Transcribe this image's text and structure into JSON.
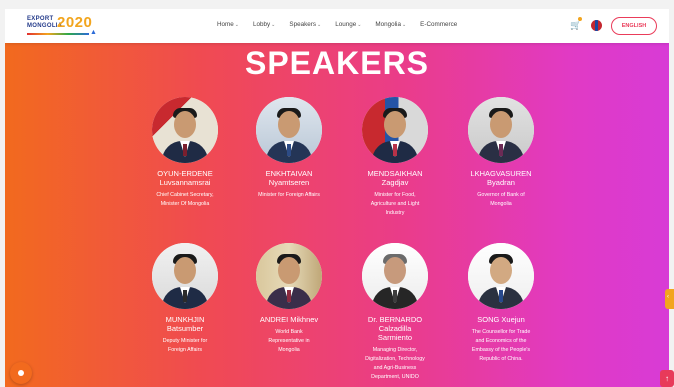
{
  "logo": {
    "line1": "EXPORT",
    "line2": "MONGOLIA",
    "year": "2020"
  },
  "nav": [
    {
      "label": "Home",
      "has_menu": true
    },
    {
      "label": "Lobby",
      "has_menu": true
    },
    {
      "label": "Speakers",
      "has_menu": true
    },
    {
      "label": "Lounge",
      "has_menu": true
    },
    {
      "label": "Mongolia",
      "has_menu": true
    },
    {
      "label": "E-Commerce",
      "has_menu": false
    }
  ],
  "header": {
    "lang_button": "ENGLISH",
    "cart_icon": "cart-icon",
    "flag_icon": "mongolia-flag-icon"
  },
  "main": {
    "title": "SPEAKERS"
  },
  "speakers": [
    {
      "name1": "OYUN-ERDENE",
      "name2": "Luvsannamsrai",
      "role": [
        "Chief Cabinet Secretary,",
        "Minister Of Mongolia"
      ]
    },
    {
      "name1": "ENKHTAIVAN",
      "name2": "Nyamtseren",
      "role": [
        "Minister for Foreign Affairs"
      ]
    },
    {
      "name1": "MENDSAIKHAN",
      "name2": "Zagdjav",
      "role": [
        "Minister for Food,",
        "Agriculture and Light",
        "Industry"
      ]
    },
    {
      "name1": "LKHAGVASUREN",
      "name2": "Byadran",
      "role": [
        "Governor of Bank of",
        "Mongolia"
      ]
    },
    {
      "name1": "MUNKHJIN",
      "name2": "Batsumber",
      "role": [
        "Deputy Minister for",
        "Foreign Affairs"
      ]
    },
    {
      "name1": "ANDREI Mikhnev",
      "name2": "",
      "role": [
        "World Bank",
        "Representative in",
        "Mongolia"
      ]
    },
    {
      "name1": "Dr. BERNARDO",
      "name2": "Calzadilla",
      "name3": "Sarmiento",
      "role": [
        "Managing Director,",
        "Digitalization, Technology",
        "and Agri-Business",
        "Department, UNIDO"
      ]
    },
    {
      "name1": "SONG Xuejun",
      "name2": "",
      "role": [
        "The Counsellor for Trade",
        "and Economics of the",
        "Embassy of the People's",
        "Republic of China."
      ]
    }
  ],
  "colors": {
    "gradient_start": "#f26a1e",
    "gradient_mid": "#ea3c8a",
    "gradient_end": "#d83bd6",
    "accent": "#ea3c5a",
    "logo_blue": "#233a8a",
    "logo_gold": "#f2a51e"
  },
  "widgets": {
    "chat_icon": "chat-bubble-icon",
    "back_to_top_icon": "arrow-up-icon",
    "side_tab_icon": "side-tab-icon"
  }
}
